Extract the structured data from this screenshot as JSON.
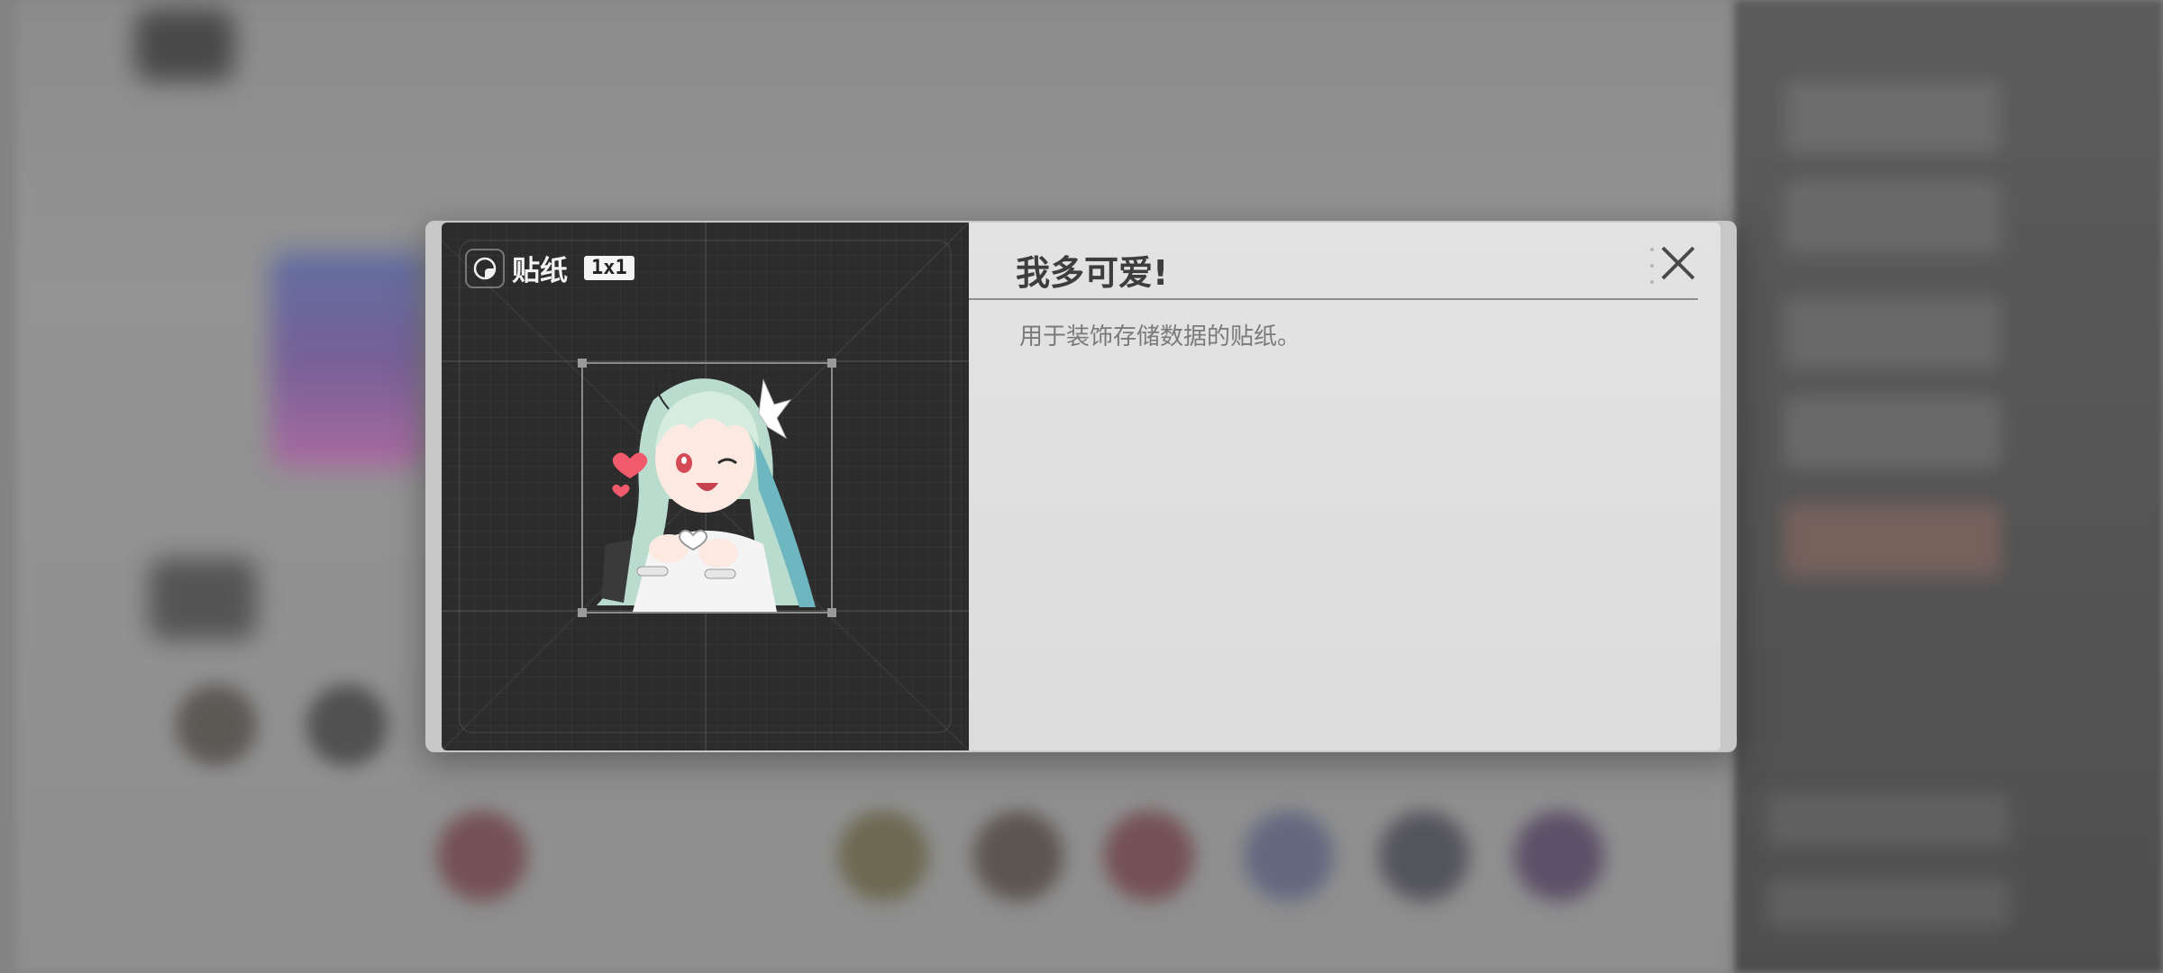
{
  "dialog": {
    "category_label": "贴纸",
    "size_badge": "1x1",
    "title": "我多可爱!",
    "description": "用于装饰存储数据的贴纸。"
  },
  "icons": {
    "category": "sticker-icon",
    "close": "close-icon",
    "more": "more-vertical-icon"
  },
  "colors": {
    "preview_bg": "#2c2c2c",
    "panel_bg": "#e0e0e0",
    "title": "#3d3d3d",
    "description": "#7a7a7a"
  }
}
